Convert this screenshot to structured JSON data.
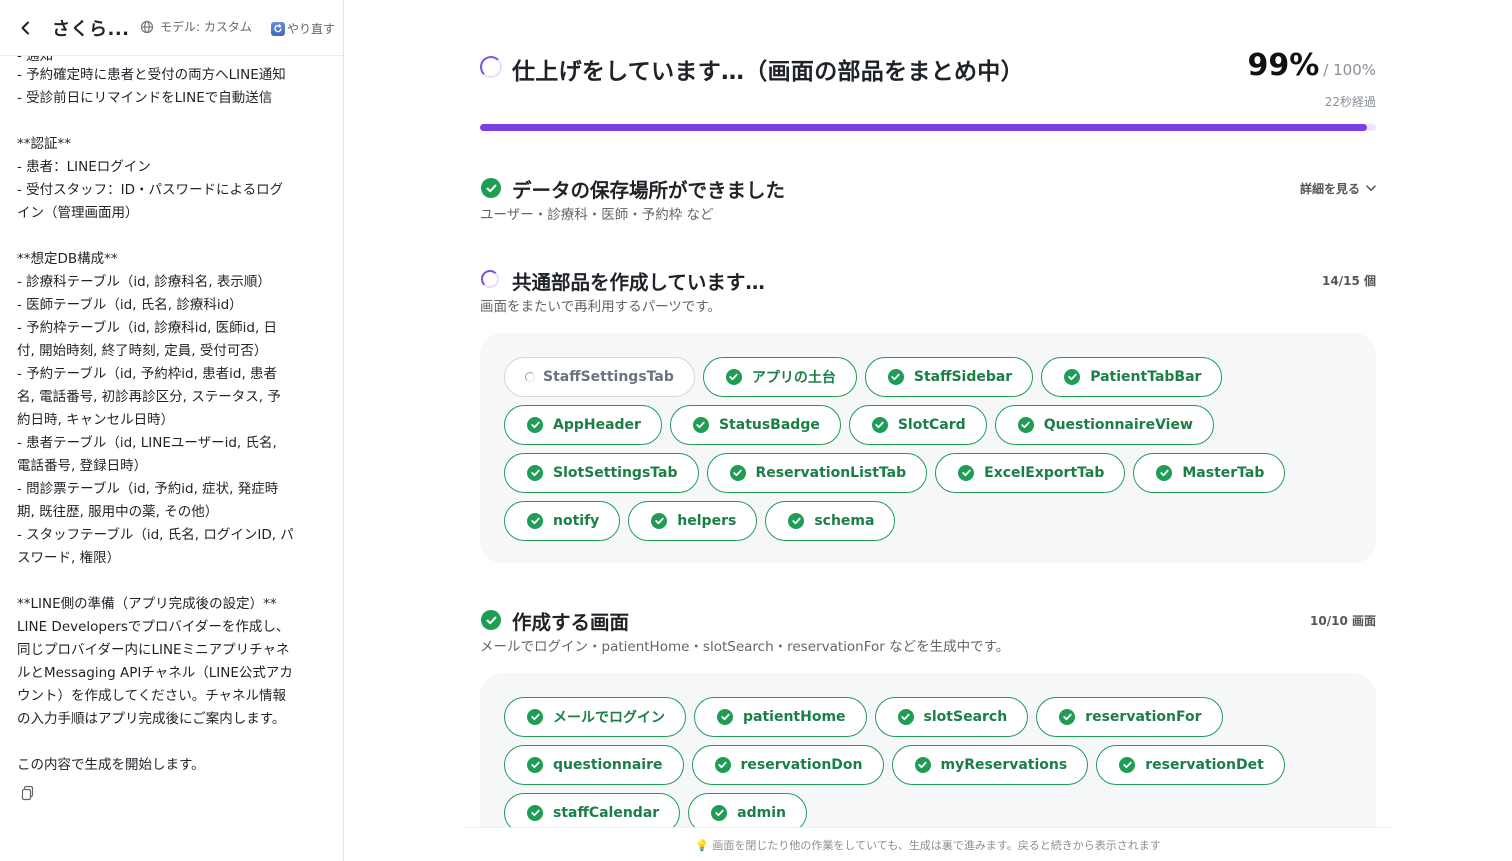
{
  "sidebar": {
    "title": "さくら...",
    "model_label": "モデル: カスタム",
    "retry_label": "やり直す",
    "clipped_line": "- 通知",
    "lines": [
      "- 予約確定時に患者と受付の両方へLINE通知",
      "- 受診前日にリマインドをLINEで自動送信",
      "",
      "**認証**",
      "- 患者：LINEログイン",
      "- 受付スタッフ：ID・パスワードによるログ",
      "イン（管理画面用）",
      "",
      "**想定DB構成**",
      "- 診療科テーブル（id, 診療科名, 表示順）",
      "- 医師テーブル（id, 氏名, 診療科id）",
      "- 予約枠テーブル（id, 診療科id, 医師id, 日",
      "付, 開始時刻, 終了時刻, 定員, 受付可否）",
      "- 予約テーブル（id, 予約枠id, 患者id, 患者",
      "名, 電話番号, 初診再診区分, ステータス, 予",
      "約日時, キャンセル日時）",
      "- 患者テーブル（id, LINEユーザーid, 氏名,",
      "電話番号, 登録日時）",
      "- 問診票テーブル（id, 予約id, 症状, 発症時",
      "期, 既往歴, 服用中の薬, その他）",
      "- スタッフテーブル（id, 氏名, ログインID, パ",
      "スワード, 権限）",
      "",
      "**LINE側の準備（アプリ完成後の設定）**",
      "LINE Developersでプロバイダーを作成し、",
      "同じプロバイダー内にLINEミニアプリチャネ",
      "ルとMessaging APIチャネル（LINE公式アカ",
      "ウント）を作成してください。チャネル情報",
      "の入力手順はアプリ完成後にご案内します。",
      "",
      "この内容で生成を開始します。"
    ]
  },
  "status": {
    "title": "仕上げをしています…（画面の部品をまとめ中）",
    "percent": "99%",
    "percent_of": "/ 100%",
    "progress_value": 99,
    "elapsed": "22秒経過"
  },
  "sections": {
    "data": {
      "title": "データの保存場所ができました",
      "subtitle": "ユーザー・診療科・医師・予約枠 など",
      "details_label": "詳細を見る"
    },
    "components": {
      "title": "共通部品を作成しています…",
      "subtitle": "画面をまたいで再利用するパーツです。",
      "count": "14/15 個",
      "chips": [
        {
          "label": "StaffSettingsTab",
          "done": false
        },
        {
          "label": "アプリの土台",
          "done": true
        },
        {
          "label": "StaffSidebar",
          "done": true
        },
        {
          "label": "PatientTabBar",
          "done": true
        },
        {
          "label": "AppHeader",
          "done": true
        },
        {
          "label": "StatusBadge",
          "done": true
        },
        {
          "label": "SlotCard",
          "done": true
        },
        {
          "label": "QuestionnaireView",
          "done": true
        },
        {
          "label": "SlotSettingsTab",
          "done": true
        },
        {
          "label": "ReservationListTab",
          "done": true
        },
        {
          "label": "ExcelExportTab",
          "done": true
        },
        {
          "label": "MasterTab",
          "done": true
        },
        {
          "label": "notify",
          "done": true
        },
        {
          "label": "helpers",
          "done": true
        },
        {
          "label": "schema",
          "done": true
        }
      ]
    },
    "screens": {
      "title": "作成する画面",
      "subtitle": "メールでログイン・patientHome・slotSearch・reservationFor などを生成中です。",
      "count": "10/10 画面",
      "chips": [
        {
          "label": "メールでログイン",
          "done": true
        },
        {
          "label": "patientHome",
          "done": true
        },
        {
          "label": "slotSearch",
          "done": true
        },
        {
          "label": "reservationFor",
          "done": true
        },
        {
          "label": "questionnaire",
          "done": true
        },
        {
          "label": "reservationDon",
          "done": true
        },
        {
          "label": "myReservations",
          "done": true
        },
        {
          "label": "reservationDet",
          "done": true
        },
        {
          "label": "staffCalendar",
          "done": true
        },
        {
          "label": "admin",
          "done": true
        }
      ]
    }
  },
  "footer": {
    "text": "💡 画面を閉じたり他の作業をしていても、生成は裏で進みます。戻ると続きから表示されます"
  },
  "colors": {
    "accent": "#7b3fe4",
    "success": "#1f9d55"
  },
  "icons": [
    "back-chevron-icon",
    "globe-icon",
    "refresh-icon",
    "copy-icon",
    "spinner-icon",
    "check-circle-icon",
    "chevron-down-icon",
    "lightbulb-icon"
  ]
}
